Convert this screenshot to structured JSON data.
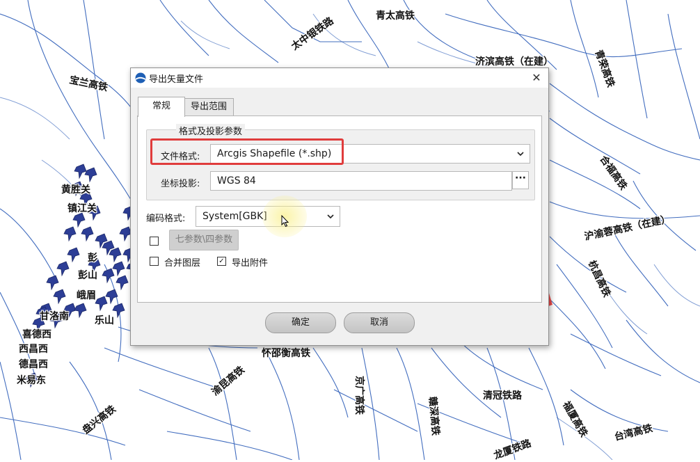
{
  "map": {
    "labels": [
      {
        "text": "青太高铁"
      },
      {
        "text": "太中银铁路"
      },
      {
        "text": "济滨高铁（在建）"
      },
      {
        "text": "宝兰高铁"
      },
      {
        "text": "黄胜关"
      },
      {
        "text": "镇江关"
      },
      {
        "text": "彭山"
      },
      {
        "text": "峨眉"
      },
      {
        "text": "甘洛南"
      },
      {
        "text": "喜德西"
      },
      {
        "text": "西昌西"
      },
      {
        "text": "德昌西"
      },
      {
        "text": "米易东"
      },
      {
        "text": "沪渝蓉高铁（在建）"
      },
      {
        "text": "怀邵衡高铁"
      },
      {
        "text": "渝昆高铁"
      },
      {
        "text": "盘兴高铁"
      },
      {
        "text": "清冠铁路"
      },
      {
        "text": "福厦高铁"
      },
      {
        "text": "台湾高铁"
      },
      {
        "text": "京广高铁"
      },
      {
        "text": "赣深高铁"
      },
      {
        "text": "合福高铁"
      },
      {
        "text": "杭昌高铁"
      },
      {
        "text": "青荣高铁"
      },
      {
        "text": "龙厦铁路"
      },
      {
        "text": "彭"
      },
      {
        "text": "乐山"
      }
    ]
  },
  "dialog": {
    "title": "导出矢量文件",
    "close_glyph": "✕",
    "tabs": [
      {
        "label": "常规",
        "active": true
      },
      {
        "label": "导出范围",
        "active": false
      }
    ],
    "group_title": "格式及投影参数",
    "file_format": {
      "label": "文件格式:",
      "value": "Arcgis Shapefile (*.shp)"
    },
    "projection": {
      "label": "坐标投影:",
      "value": "WGS 84",
      "browse_label": "···"
    },
    "encoding": {
      "label": "编码格式:",
      "value": "System[GBK]"
    },
    "seven_params": {
      "label": "七参数\\四参数",
      "checked": false,
      "enabled": false
    },
    "merge_layers": {
      "label": "合并图层",
      "checked": false
    },
    "export_attachments": {
      "label": "导出附件",
      "checked": true,
      "check_glyph": "✓"
    },
    "ok_label": "确定",
    "cancel_label": "取消"
  },
  "colors": {
    "highlight": "#e03c3c",
    "arrow": "#ee4b4b",
    "rail": "#1f4fa8",
    "pin": "#2d3e96"
  }
}
